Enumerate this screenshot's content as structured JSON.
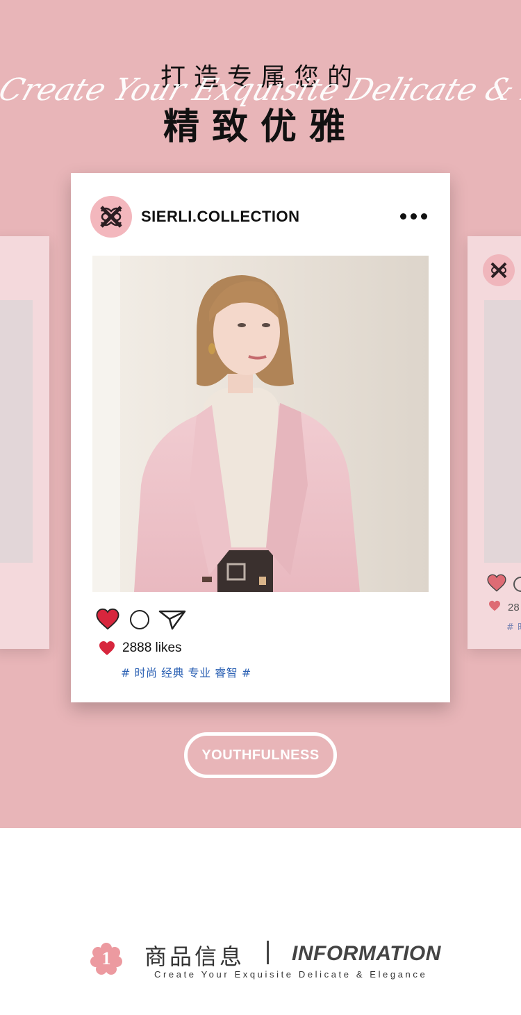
{
  "hero": {
    "title_top": "打造专属您的",
    "script_text": "Create Your Exquisite Delicate & Elegance",
    "title_main": "精致优雅"
  },
  "post": {
    "account_name": "SIERLI.COLLECTION",
    "likes": "2888 likes",
    "tags": "# 时尚 经典 专业 睿智 #"
  },
  "side_card": {
    "likes": "28",
    "tags": "# 时"
  },
  "button": {
    "label": "YOUTHFULNESS"
  },
  "section": {
    "number": "1",
    "title_cn": "商品信息",
    "title_en": "INFORMATION",
    "subtitle": "Create Your Exquisite Delicate & Elegance"
  },
  "colors": {
    "background_pink": "#e8b5b8",
    "card_white": "#ffffff",
    "heart_red": "#d7263d",
    "tag_blue": "#2d62b4"
  },
  "icons": {
    "avatar": "sierli-logo-icon",
    "menu": "more-dots-icon",
    "like": "heart-icon",
    "comment": "comment-circle-icon",
    "share": "paper-plane-icon"
  }
}
